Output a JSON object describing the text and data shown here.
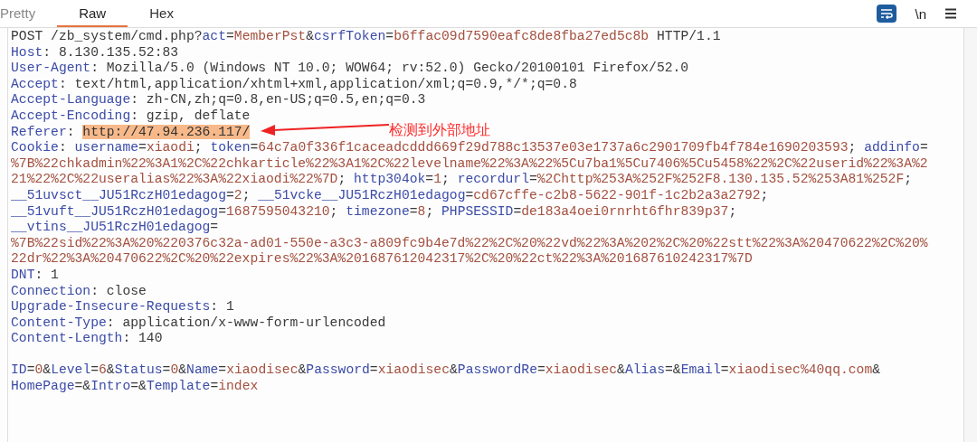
{
  "tabs": [
    {
      "label": "Pretty",
      "selected": false
    },
    {
      "label": "Raw",
      "selected": true
    },
    {
      "label": "Hex",
      "selected": false
    }
  ],
  "toolbar": {
    "wrap_on": true,
    "newline_label": "\\n"
  },
  "lines": [
    {
      "segments": [
        {
          "kind": "plain",
          "text": "POST /zb_system/cmd.php?"
        },
        {
          "kind": "key",
          "text": "act"
        },
        {
          "kind": "plain",
          "text": "="
        },
        {
          "kind": "value",
          "text": "MemberPst"
        },
        {
          "kind": "plain",
          "text": "&"
        },
        {
          "kind": "key",
          "text": "csrfToken"
        },
        {
          "kind": "plain",
          "text": "="
        },
        {
          "kind": "value",
          "text": "b6ffac09d7590eafc8de8fba27ed5c8b"
        },
        {
          "kind": "plain",
          "text": " HTTP/1.1"
        }
      ]
    },
    {
      "segments": [
        {
          "kind": "key",
          "text": "Host"
        },
        {
          "kind": "plain",
          "text": ": 8.130.135.52:83"
        }
      ]
    },
    {
      "segments": [
        {
          "kind": "key",
          "text": "User-Agent"
        },
        {
          "kind": "plain",
          "text": ": Mozilla/5.0 (Windows NT 10.0; WOW64; rv:52.0) Gecko/20100101 Firefox/52.0"
        }
      ]
    },
    {
      "segments": [
        {
          "kind": "key",
          "text": "Accept"
        },
        {
          "kind": "plain",
          "text": ": text/html,application/xhtml+xml,application/xml;q=0.9,*/*;q=0.8"
        }
      ]
    },
    {
      "segments": [
        {
          "kind": "key",
          "text": "Accept-Language"
        },
        {
          "kind": "plain",
          "text": ": zh-CN,zh;q=0.8,en-US;q=0.5,en;q=0.3"
        }
      ]
    },
    {
      "segments": [
        {
          "kind": "key",
          "text": "Accept-Encoding"
        },
        {
          "kind": "plain",
          "text": ": gzip, deflate"
        }
      ]
    },
    {
      "segments": [
        {
          "kind": "key",
          "text": "Referer"
        },
        {
          "kind": "plain",
          "text": ": "
        },
        {
          "kind": "highlight",
          "text": "http://47.94.236.117/"
        }
      ]
    },
    {
      "segments": [
        {
          "kind": "key",
          "text": "Cookie"
        },
        {
          "kind": "plain",
          "text": ": "
        },
        {
          "kind": "key",
          "text": "username"
        },
        {
          "kind": "plain",
          "text": "="
        },
        {
          "kind": "value",
          "text": "xiaodi"
        },
        {
          "kind": "plain",
          "text": "; "
        },
        {
          "kind": "key",
          "text": "token"
        },
        {
          "kind": "plain",
          "text": "="
        },
        {
          "kind": "value",
          "text": "64c7a0f336f1caceadcddd669f29d788c13537e03e1737a6c2901709fb4f784e1690203593"
        },
        {
          "kind": "plain",
          "text": "; "
        },
        {
          "kind": "key",
          "text": "addinfo"
        },
        {
          "kind": "plain",
          "text": "="
        }
      ]
    },
    {
      "segments": [
        {
          "kind": "value",
          "text": "%7B%22chkadmin%22%3A1%2C%22chkarticle%22%3A1%2C%22levelname%22%3A%22%5Cu7ba1%5Cu7406%5Cu5458%22%2C%22userid%22%3A%2"
        }
      ]
    },
    {
      "segments": [
        {
          "kind": "value",
          "text": "21%22%2C%22useralias%22%3A%22xiaodi%22%7D"
        },
        {
          "kind": "plain",
          "text": "; "
        },
        {
          "kind": "key",
          "text": "http304ok"
        },
        {
          "kind": "plain",
          "text": "="
        },
        {
          "kind": "value",
          "text": "1"
        },
        {
          "kind": "plain",
          "text": "; "
        },
        {
          "kind": "key",
          "text": "recordurl"
        },
        {
          "kind": "plain",
          "text": "="
        },
        {
          "kind": "value",
          "text": "%2Chttp%253A%252F%252F8.130.135.52%253A81%252F"
        },
        {
          "kind": "plain",
          "text": ";"
        }
      ]
    },
    {
      "segments": [
        {
          "kind": "key",
          "text": "__51uvsct__JU51RczH01edagog"
        },
        {
          "kind": "plain",
          "text": "="
        },
        {
          "kind": "value",
          "text": "2"
        },
        {
          "kind": "plain",
          "text": "; "
        },
        {
          "kind": "key",
          "text": "__51vcke__JU51RczH01edagog"
        },
        {
          "kind": "plain",
          "text": "="
        },
        {
          "kind": "value",
          "text": "cd67cffe-c2b8-5622-901f-1c2b2a3a2792"
        },
        {
          "kind": "plain",
          "text": ";"
        }
      ]
    },
    {
      "segments": [
        {
          "kind": "key",
          "text": "__51vuft__JU51RczH01edagog"
        },
        {
          "kind": "plain",
          "text": "="
        },
        {
          "kind": "value",
          "text": "1687595043210"
        },
        {
          "kind": "plain",
          "text": "; "
        },
        {
          "kind": "key",
          "text": "timezone"
        },
        {
          "kind": "plain",
          "text": "="
        },
        {
          "kind": "value",
          "text": "8"
        },
        {
          "kind": "plain",
          "text": "; "
        },
        {
          "kind": "key",
          "text": "PHPSESSID"
        },
        {
          "kind": "plain",
          "text": "="
        },
        {
          "kind": "value",
          "text": "de183a4oei0rnrht6fhr839p37"
        },
        {
          "kind": "plain",
          "text": ";"
        }
      ]
    },
    {
      "segments": [
        {
          "kind": "key",
          "text": "__vtins__JU51RczH01edagog"
        },
        {
          "kind": "plain",
          "text": "="
        }
      ]
    },
    {
      "segments": [
        {
          "kind": "value",
          "text": "%7B%22sid%22%3A%20%220376c32a-ad01-550e-a3c3-a809fc9b4e7d%22%2C%20%22vd%22%3A%202%2C%20%22stt%22%3A%20470622%2C%20%"
        }
      ]
    },
    {
      "segments": [
        {
          "kind": "value",
          "text": "22dr%22%3A%20470622%2C%20%22expires%22%3A%201687612042317%2C%20%22ct%22%3A%201687610242317%7D"
        }
      ]
    },
    {
      "segments": [
        {
          "kind": "key",
          "text": "DNT"
        },
        {
          "kind": "plain",
          "text": ": 1"
        }
      ]
    },
    {
      "segments": [
        {
          "kind": "key",
          "text": "Connection"
        },
        {
          "kind": "plain",
          "text": ": close"
        }
      ]
    },
    {
      "segments": [
        {
          "kind": "key",
          "text": "Upgrade-Insecure-Requests"
        },
        {
          "kind": "plain",
          "text": ": 1"
        }
      ]
    },
    {
      "segments": [
        {
          "kind": "key",
          "text": "Content-Type"
        },
        {
          "kind": "plain",
          "text": ": application/x-www-form-urlencoded"
        }
      ]
    },
    {
      "segments": [
        {
          "kind": "key",
          "text": "Content-Length"
        },
        {
          "kind": "plain",
          "text": ": 140"
        }
      ]
    },
    {
      "blank_before": true,
      "segments": [
        {
          "kind": "key",
          "text": "ID"
        },
        {
          "kind": "plain",
          "text": "="
        },
        {
          "kind": "value",
          "text": "0"
        },
        {
          "kind": "plain",
          "text": "&"
        },
        {
          "kind": "key",
          "text": "Level"
        },
        {
          "kind": "plain",
          "text": "="
        },
        {
          "kind": "value",
          "text": "6"
        },
        {
          "kind": "plain",
          "text": "&"
        },
        {
          "kind": "key",
          "text": "Status"
        },
        {
          "kind": "plain",
          "text": "="
        },
        {
          "kind": "value",
          "text": "0"
        },
        {
          "kind": "plain",
          "text": "&"
        },
        {
          "kind": "key",
          "text": "Name"
        },
        {
          "kind": "plain",
          "text": "="
        },
        {
          "kind": "value",
          "text": "xiaodisec"
        },
        {
          "kind": "plain",
          "text": "&"
        },
        {
          "kind": "key",
          "text": "Password"
        },
        {
          "kind": "plain",
          "text": "="
        },
        {
          "kind": "value",
          "text": "xiaodisec"
        },
        {
          "kind": "plain",
          "text": "&"
        },
        {
          "kind": "key",
          "text": "PasswordRe"
        },
        {
          "kind": "plain",
          "text": "="
        },
        {
          "kind": "value",
          "text": "xiaodisec"
        },
        {
          "kind": "plain",
          "text": "&"
        },
        {
          "kind": "key",
          "text": "Alias"
        },
        {
          "kind": "plain",
          "text": "=&"
        },
        {
          "kind": "key",
          "text": "Email"
        },
        {
          "kind": "plain",
          "text": "="
        },
        {
          "kind": "value",
          "text": "xiaodisec%40qq.com"
        },
        {
          "kind": "plain",
          "text": "&"
        }
      ]
    },
    {
      "segments": [
        {
          "kind": "key",
          "text": "HomePage"
        },
        {
          "kind": "plain",
          "text": "=&"
        },
        {
          "kind": "key",
          "text": "Intro"
        },
        {
          "kind": "plain",
          "text": "=&"
        },
        {
          "kind": "key",
          "text": "Template"
        },
        {
          "kind": "plain",
          "text": "="
        },
        {
          "kind": "value",
          "text": "index"
        }
      ]
    }
  ],
  "annotation": {
    "text": "检测到外部地址"
  }
}
